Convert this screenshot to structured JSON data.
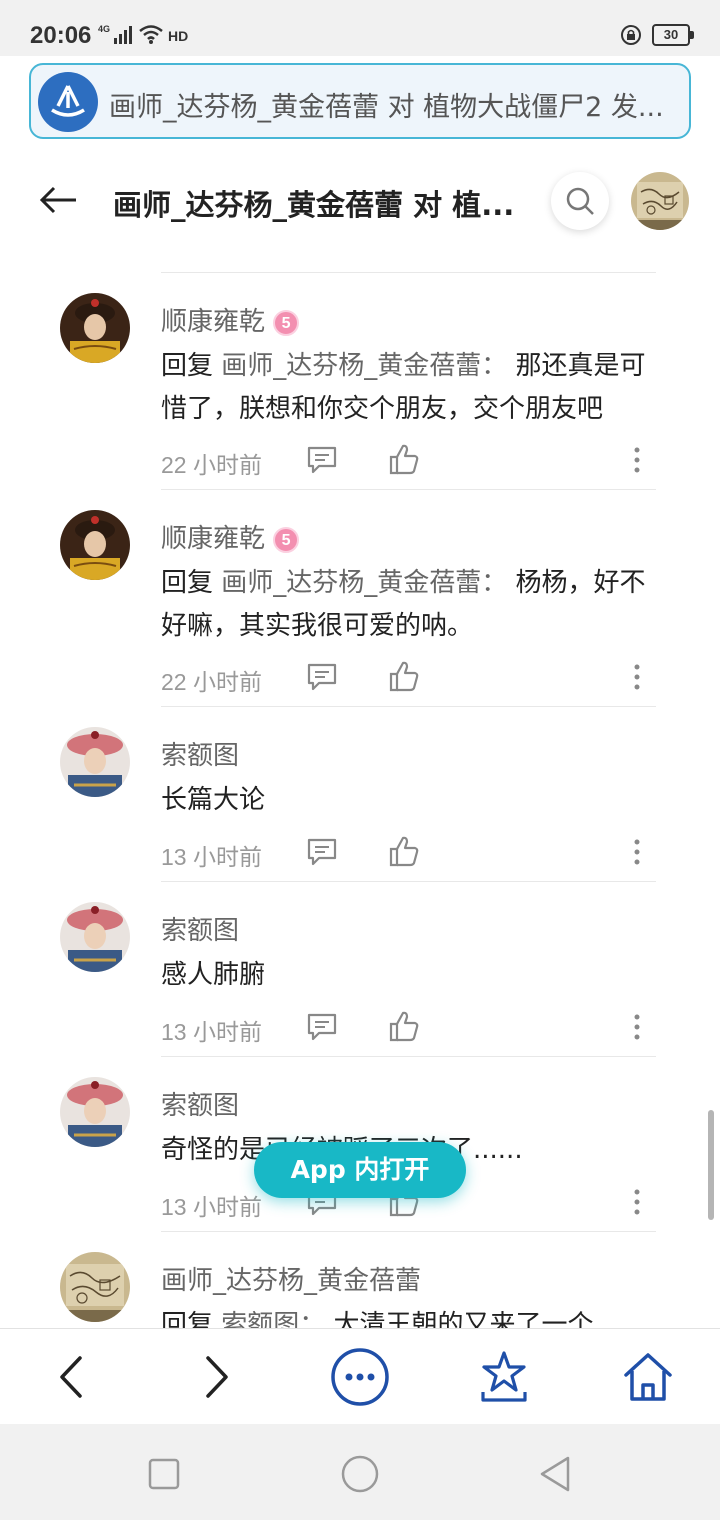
{
  "status_bar": {
    "time": "20:06",
    "network": "4G",
    "hd": "HD",
    "battery": "30"
  },
  "url_bar": {
    "text": "画师_达芬杨_黄金蓓蕾 对 植物大战僵尸2 发..."
  },
  "header": {
    "title": "画师_达芬杨_黄金蓓蕾 对 植..."
  },
  "comments": [
    {
      "name": "顺康雍乾",
      "level": "5",
      "reply_prefix": "回复 ",
      "reply_target": "画师_达芬杨_黄金蓓蕾：",
      "text": " 那还真是可惜了，朕想和你交个朋友，交个朋友吧",
      "time": "22 小时前"
    },
    {
      "name": "顺康雍乾",
      "level": "5",
      "reply_prefix": "回复 ",
      "reply_target": "画师_达芬杨_黄金蓓蕾：",
      "text": " 杨杨，好不好嘛，其实我很可爱的呐。",
      "time": "22 小时前"
    },
    {
      "name": "索额图",
      "text": "长篇大论",
      "time": "13 小时前"
    },
    {
      "name": "索额图",
      "text": "感人肺腑",
      "time": "13 小时前"
    },
    {
      "name": "索额图",
      "text": "奇怪的是已经被踩了三次了......",
      "time": "13 小时前"
    },
    {
      "name": "画师_达芬杨_黄金蓓蕾",
      "reply_prefix": "回复 ",
      "reply_target": "索额图：",
      "text": " 大清王朝的又来了一个"
    }
  ],
  "open_app_button": "App 内打开",
  "colors": {
    "accent_teal": "#18b8c6",
    "toolbar_blue": "#1f4fa8",
    "url_border": "#47b6d6",
    "level_badge_pink": "#f38fb0"
  },
  "icons": {
    "toolbar": [
      "chevron-left-icon",
      "chevron-right-icon",
      "more-menu-icon",
      "star-icon",
      "home-icon"
    ],
    "navbar": [
      "recents-square-icon",
      "home-circle-icon",
      "back-triangle-icon"
    ]
  }
}
